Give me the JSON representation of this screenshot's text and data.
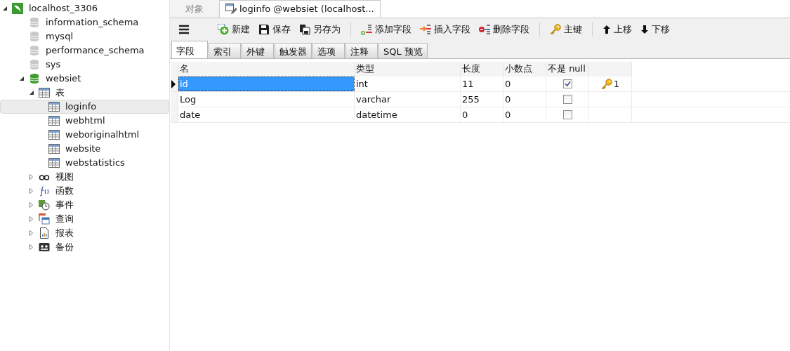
{
  "tree": [
    {
      "label": "localhost_3306",
      "kind": "server",
      "expanded": true,
      "selected": false,
      "children": [
        {
          "label": "information_schema",
          "kind": "db-off",
          "selected": false
        },
        {
          "label": "mysql",
          "kind": "db-off",
          "selected": false
        },
        {
          "label": "performance_schema",
          "kind": "db-off",
          "selected": false
        },
        {
          "label": "sys",
          "kind": "db-off",
          "selected": false
        },
        {
          "label": "websiet",
          "kind": "db-on",
          "expanded": true,
          "selected": false,
          "children": [
            {
              "label": "表",
              "kind": "table",
              "expanded": true,
              "selected": false,
              "children": [
                {
                  "label": "loginfo",
                  "kind": "table",
                  "selected": true
                },
                {
                  "label": "webhtml",
                  "kind": "table",
                  "selected": false
                },
                {
                  "label": "weboriginalhtml",
                  "kind": "table",
                  "selected": false
                },
                {
                  "label": "website",
                  "kind": "table",
                  "selected": false
                },
                {
                  "label": "webstatistics",
                  "kind": "table",
                  "selected": false
                }
              ]
            },
            {
              "label": "视图",
              "kind": "view",
              "expanded": false,
              "selected": false
            },
            {
              "label": "函数",
              "kind": "function",
              "expanded": false,
              "selected": false
            },
            {
              "label": "事件",
              "kind": "event",
              "expanded": false,
              "selected": false
            },
            {
              "label": "查询",
              "kind": "query",
              "expanded": false,
              "selected": false
            },
            {
              "label": "报表",
              "kind": "report",
              "expanded": false,
              "selected": false
            },
            {
              "label": "备份",
              "kind": "backup",
              "expanded": false,
              "selected": false
            }
          ]
        }
      ]
    }
  ],
  "tabs": [
    {
      "label": "对象",
      "selected": false
    },
    {
      "label": "loginfo @websiet (localhost...",
      "selected": true,
      "icon": true
    }
  ],
  "toolbar": [
    {
      "label": "新建",
      "kind": "new"
    },
    {
      "label": "保存",
      "kind": "save"
    },
    {
      "label": "另存为",
      "kind": "saveas"
    },
    {
      "kind": "sep"
    },
    {
      "label": "添加字段",
      "kind": "add"
    },
    {
      "label": "插入字段",
      "kind": "insert"
    },
    {
      "label": "删除字段",
      "kind": "delete"
    },
    {
      "kind": "sep"
    },
    {
      "label": "主键",
      "kind": "key"
    },
    {
      "kind": "sep"
    },
    {
      "label": "上移",
      "kind": "up"
    },
    {
      "label": "下移",
      "kind": "down"
    }
  ],
  "subtabs": [
    {
      "label": "字段",
      "selected": true
    },
    {
      "label": "索引",
      "selected": false
    },
    {
      "label": "外键",
      "selected": false
    },
    {
      "label": "触发器",
      "selected": false
    },
    {
      "label": "选项",
      "selected": false
    },
    {
      "label": "注释",
      "selected": false
    },
    {
      "label": "SQL 预览",
      "selected": false
    }
  ],
  "columns": [
    "名",
    "类型",
    "长度",
    "小数点",
    "不是 null"
  ],
  "rows": [
    {
      "name": "id",
      "type": "int",
      "length": "11",
      "decimals": "0",
      "not_null": true,
      "key": "1",
      "selected": true
    },
    {
      "name": "Log",
      "type": "varchar",
      "length": "255",
      "decimals": "0",
      "not_null": false,
      "selected": false
    },
    {
      "name": "date",
      "type": "datetime",
      "length": "0",
      "decimals": "0",
      "not_null": false,
      "selected": false
    }
  ]
}
